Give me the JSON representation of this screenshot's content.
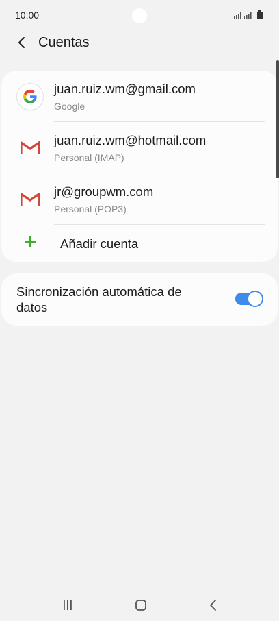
{
  "status_bar": {
    "time": "10:00",
    "icons": [
      "wifi-signal-icon",
      "cell-signal-icon",
      "battery-icon"
    ]
  },
  "header": {
    "back_icon": "chevron-left-icon",
    "title": "Cuentas"
  },
  "accounts": [
    {
      "name": "juan.ruiz.wm@gmail.com",
      "type": "Google",
      "icon": "google-icon"
    },
    {
      "name": "juan.ruiz.wm@hotmail.com",
      "type": "Personal (IMAP)",
      "icon": "gmail-icon"
    },
    {
      "name": "jr@groupwm.com",
      "type": "Personal (POP3)",
      "icon": "gmail-icon"
    }
  ],
  "add_account": {
    "label": "Añadir cuenta",
    "icon": "plus-icon"
  },
  "sync": {
    "label": "Sincronización automática de datos",
    "enabled": true
  },
  "colors": {
    "accent": "#3e8bea",
    "add_green": "#3fae2a",
    "gmail_red": "#d44638",
    "background": "#f2f2f2",
    "card": "#fcfcfc"
  },
  "nav_bar": {
    "icons": [
      "recents-icon",
      "home-icon",
      "back-icon"
    ]
  }
}
